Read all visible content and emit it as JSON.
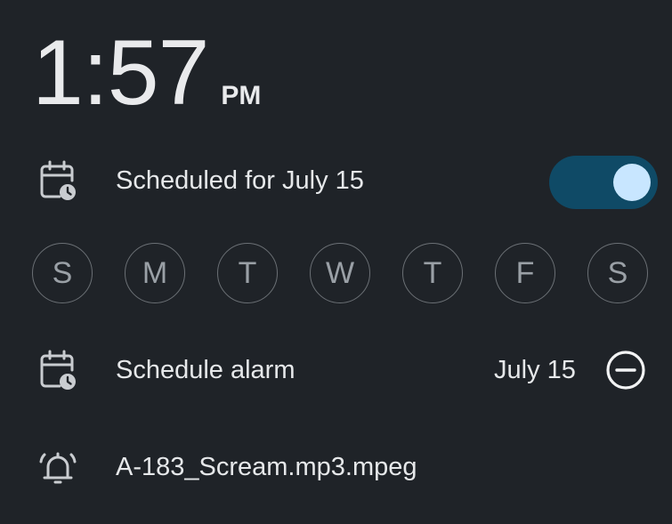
{
  "alarm": {
    "time": "1:57",
    "ampm": "PM"
  },
  "schedule_status": {
    "label": "Scheduled for July 15",
    "icon": "calendar-clock-icon",
    "enabled": true,
    "toggle_color": "#0f4a66",
    "knob_color": "#c8e6ff"
  },
  "days": [
    {
      "letter": "S"
    },
    {
      "letter": "M"
    },
    {
      "letter": "T"
    },
    {
      "letter": "W"
    },
    {
      "letter": "T"
    },
    {
      "letter": "F"
    },
    {
      "letter": "S"
    }
  ],
  "schedule_alarm": {
    "label": "Schedule alarm",
    "date": "July 15",
    "icon": "calendar-clock-icon",
    "remove_icon": "remove-circle-icon"
  },
  "sound": {
    "label": "A-183_Scream.mp3.mpeg",
    "icon": "alarm-bell-icon"
  }
}
